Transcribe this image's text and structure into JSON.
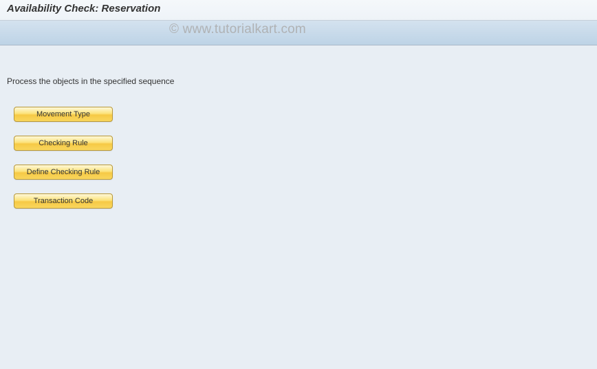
{
  "header": {
    "title": "Availability Check: Reservation"
  },
  "content": {
    "instruction": "Process the objects in the specified sequence"
  },
  "buttons": {
    "movement_type": "Movement Type",
    "checking_rule": "Checking Rule",
    "define_checking_rule": "Define Checking Rule",
    "transaction_code": "Transaction Code"
  },
  "watermark": "© www.tutorialkart.com"
}
